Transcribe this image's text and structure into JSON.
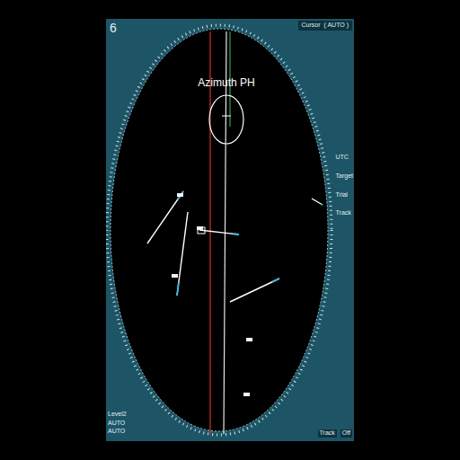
{
  "screen_number": "6",
  "title_overlay": "Azimuth PH",
  "cursor": {
    "label": "Cursor",
    "mode": "( AUTO )"
  },
  "side_labels": [
    "UTC",
    "Target",
    "Trial",
    "Track"
  ],
  "bottom_left": [
    "Level2",
    "AUTO",
    "AUTO"
  ],
  "bottom_right": [
    "Track",
    "Off"
  ]
}
